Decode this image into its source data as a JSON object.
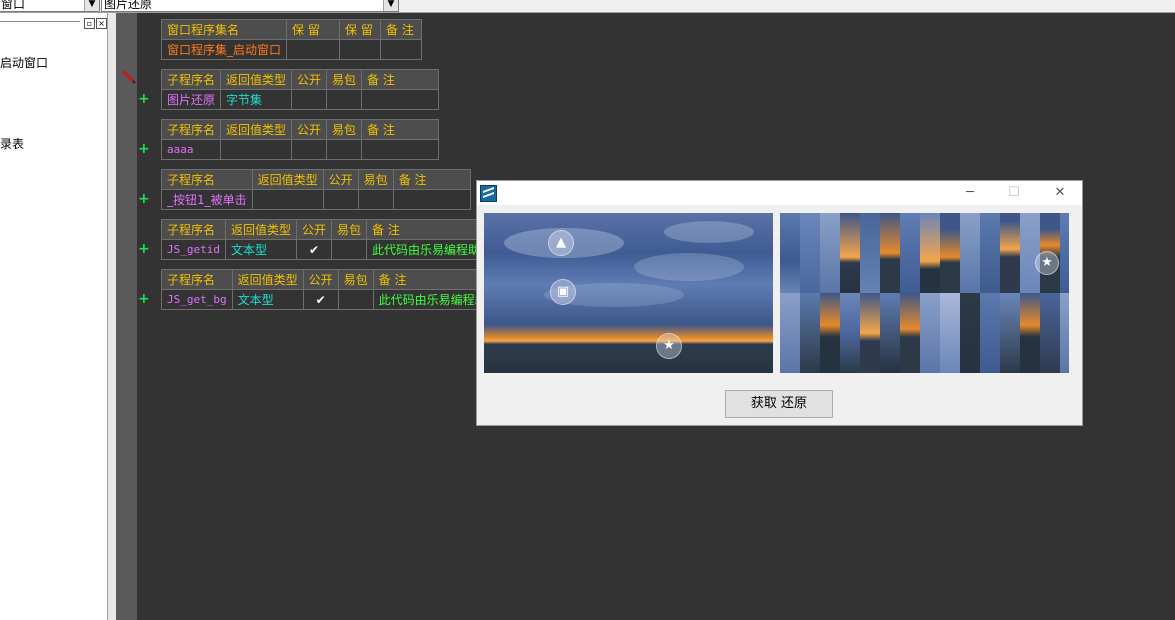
{
  "topbar": {
    "left_combo": "窗口",
    "right_combo": "图片还原"
  },
  "left_panel": {
    "items": [
      "启动窗口",
      "录表"
    ]
  },
  "tables": [
    {
      "headers": [
        "窗口程序集名",
        "保 留",
        "保 留",
        "备 注"
      ],
      "row": [
        "窗口程序集_启动窗口",
        "",
        "",
        ""
      ]
    },
    {
      "headers": [
        "子程序名",
        "返回值类型",
        "公开",
        "易包",
        "备 注"
      ],
      "row": [
        "图片还原",
        "字节集",
        "",
        "",
        ""
      ]
    },
    {
      "headers": [
        "子程序名",
        "返回值类型",
        "公开",
        "易包",
        "备 注"
      ],
      "row": [
        "aaaa",
        "",
        "",
        "",
        ""
      ]
    },
    {
      "headers": [
        "子程序名",
        "返回值类型",
        "公开",
        "易包",
        "备 注"
      ],
      "row": [
        "_按钮1_被单击",
        "",
        "",
        "",
        ""
      ]
    },
    {
      "headers": [
        "子程序名",
        "返回值类型",
        "公开",
        "易包",
        "备 注"
      ],
      "row": [
        "JS_getid",
        "文本型",
        "✔",
        "",
        "此代码由乐易编程助"
      ]
    },
    {
      "headers": [
        "子程序名",
        "返回值类型",
        "公开",
        "易包",
        "备 注"
      ],
      "row": [
        "JS_get_bg",
        "文本型",
        "✔",
        "",
        "此代码由乐易编程助"
      ]
    }
  ],
  "gutter": {
    "plus": "+"
  },
  "dialog": {
    "minimize": "─",
    "maximize": "☐",
    "close": "✕",
    "button_label": "获取 还原"
  },
  "icons": {
    "pencil": "pencil-icon",
    "app": "app-icon"
  }
}
